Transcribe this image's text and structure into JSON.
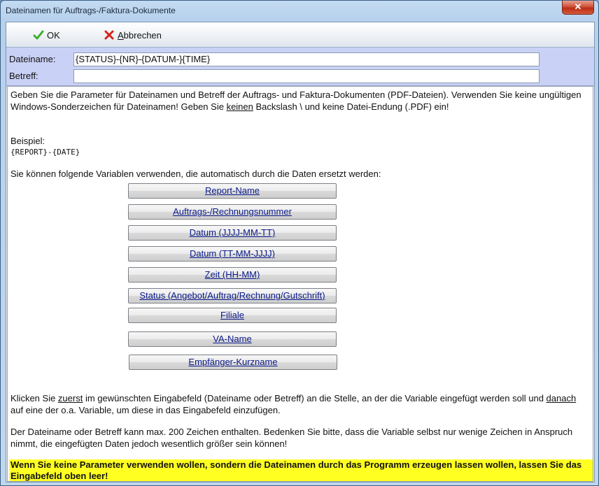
{
  "window": {
    "title": "Dateinamen für Auftrags-/Faktura-Dokumente",
    "close_label": "✕"
  },
  "toolbar": {
    "ok_label": "OK",
    "cancel_prefix": "A",
    "cancel_rest": "bbrechen"
  },
  "form": {
    "filename_label": "Dateiname:",
    "filename_value": "{STATUS}-{NR}-{DATUM-}{TIME}",
    "subject_label": "Betreff:",
    "subject_value": ""
  },
  "content": {
    "intro_1": "Geben Sie die Parameter für Dateinamen und Betreff der Auftrags- und Faktura-Dokumenten (PDF-Dateien). Verwenden Sie keine ungültigen Windows-Sonderzeichen für Dateinamen! Geben Sie ",
    "intro_keinen": "keinen",
    "intro_2": " Backslash \\ und keine Datei-Endung (.PDF) ein!",
    "example_label": "Beispiel:",
    "example_code": "{REPORT}-{DATE}",
    "variables_intro": "Sie können folgende Variablen verwenden, die automatisch durch die Daten ersetzt werden:",
    "variable_buttons": [
      "Report-Name",
      "Auftrags-/Rechnungsnummer",
      "Datum (JJJJ-MM-TT)",
      "Datum (TT-MM-JJJJ)",
      "Zeit (HH-MM)",
      "Status (Angebot/Auftrag/Rechnung/Gutschrift)",
      "Filiale",
      "VA-Name",
      "Empfänger-Kurzname"
    ],
    "click_1": "Klicken Sie ",
    "click_zuerst": "zuerst",
    "click_2": " im gewünschten Eingabefeld (Dateiname oder Betreff) an die Stelle, an der die Variable eingefügt werden soll und ",
    "click_danach": "danach",
    "click_3": " auf eine der o.a. Variable, um diese in das Eingabefeld einzufügen.",
    "limit_text": "Der Dateiname oder Betreff kann max. 200 Zeichen enthalten. Bedenken Sie bitte, dass die Variable selbst nur wenige Zeichen in Anspruch nimmt, die eingefügten Daten jedoch wesentlich größer sein können!",
    "warning_text": "Wenn Sie keine Parameter verwenden wollen, sondern die Dateinamen durch das Programm erzeugen lassen wollen, lassen Sie das Eingabefeld oben leer!"
  },
  "colors": {
    "form_background": "#c9d1f6",
    "warning_highlight": "#ffff22",
    "link_blue": "#0a1a8a",
    "ok_icon": "#3fae2a",
    "cancel_icon": "#d8231a"
  },
  "icons": {
    "ok": "checkmark-icon",
    "cancel": "red-x-icon"
  }
}
